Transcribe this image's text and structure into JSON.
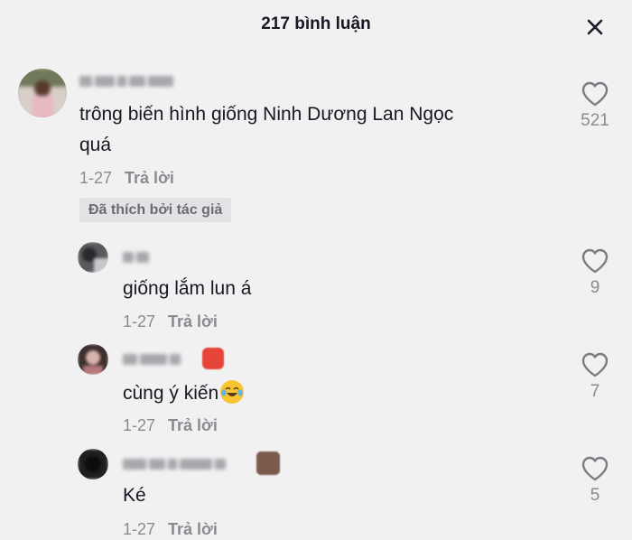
{
  "header": {
    "title": "217 bình luận",
    "close_icon": "close-icon"
  },
  "comments": [
    {
      "text": "trông biến hình giống Ninh Dương Lan Ngọc quá",
      "line1": "trông biến hình giống Ninh Dương Lan Ngọc",
      "line2": "quá",
      "date": "1-27",
      "reply": "Trả lời",
      "badge": "Đã thích bởi tác giả",
      "likes": "521"
    }
  ],
  "replies": [
    {
      "text": "giống lắm lun á",
      "date": "1-27",
      "reply": "Trả lời",
      "likes": "9"
    },
    {
      "text": "cùng ý kiến",
      "emoji": "laughing-tears-emoji",
      "date": "1-27",
      "reply": "Trả lời",
      "likes": "7"
    },
    {
      "text": "Ké",
      "date": "1-27",
      "reply": "Trả lời",
      "likes": "5"
    }
  ],
  "colors": {
    "background": "#f1f1f2",
    "text": "#161823",
    "muted": "#8a8b91"
  }
}
